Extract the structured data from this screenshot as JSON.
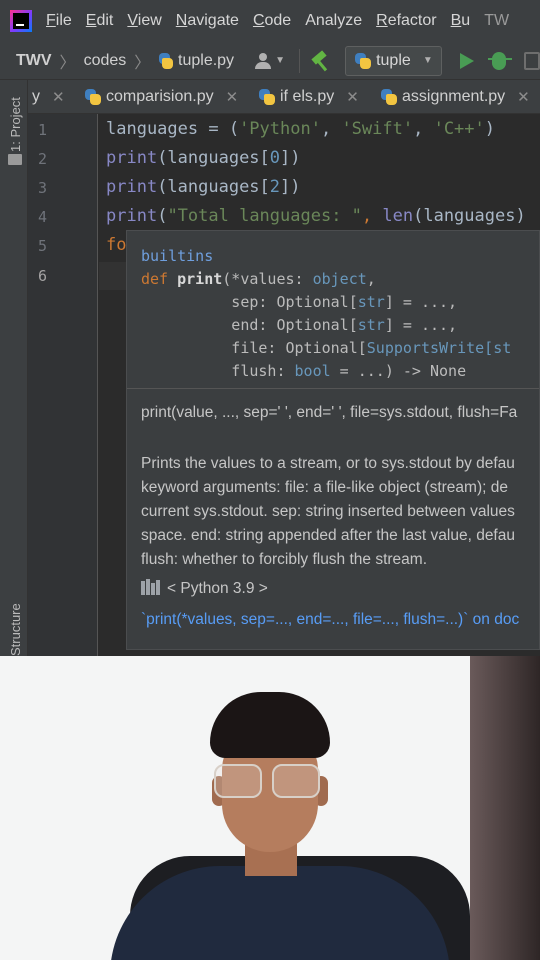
{
  "menubar": {
    "items": [
      {
        "label": "File",
        "mnemonic": "F",
        "rest": "ile"
      },
      {
        "label": "Edit",
        "mnemonic": "E",
        "rest": "dit"
      },
      {
        "label": "View",
        "mnemonic": "V",
        "rest": "iew"
      },
      {
        "label": "Navigate",
        "mnemonic": "N",
        "rest": "avigate"
      },
      {
        "label": "Code",
        "mnemonic": "C",
        "rest": "ode"
      },
      {
        "label": "Analyze",
        "mnemonic": "",
        "rest": "Analyze"
      },
      {
        "label": "Refactor",
        "mnemonic": "R",
        "rest": "efactor"
      },
      {
        "label": "Bu",
        "mnemonic": "B",
        "rest": "u"
      }
    ],
    "project_short": "TW"
  },
  "toolbar": {
    "breadcrumbs": [
      "TWV",
      "codes",
      "tuple.py"
    ],
    "run_config": "tuple"
  },
  "tool_windows": {
    "project": "1: Project",
    "structure": "Structure"
  },
  "tabs": [
    {
      "label": "y"
    },
    {
      "label": "comparision.py"
    },
    {
      "label": "if els.py"
    },
    {
      "label": "assignment.py"
    }
  ],
  "editor": {
    "line_numbers": [
      "1",
      "2",
      "3",
      "4",
      "5",
      "6"
    ],
    "current_line": "6",
    "lines": [
      {
        "parts": [
          {
            "t": "languages = (",
            "c": ""
          },
          {
            "t": "'Python'",
            "c": "str"
          },
          {
            "t": ", ",
            "c": ""
          },
          {
            "t": "'Swift'",
            "c": "str"
          },
          {
            "t": ", ",
            "c": ""
          },
          {
            "t": "'C++'",
            "c": "str"
          },
          {
            "t": ")",
            "c": ""
          }
        ]
      },
      {
        "parts": [
          {
            "t": "print",
            "c": "kw-fn"
          },
          {
            "t": "(languages[",
            "c": ""
          },
          {
            "t": "0",
            "c": "num"
          },
          {
            "t": "])",
            "c": ""
          }
        ]
      },
      {
        "parts": [
          {
            "t": "print",
            "c": "kw-fn"
          },
          {
            "t": "(languages[",
            "c": ""
          },
          {
            "t": "2",
            "c": "num"
          },
          {
            "t": "])",
            "c": ""
          }
        ]
      },
      {
        "parts": [
          {
            "t": "print",
            "c": "kw-fn"
          },
          {
            "t": "(",
            "c": ""
          },
          {
            "t": "\"Total languages: \"",
            "c": "str"
          },
          {
            "t": ", ",
            "c": "kw"
          },
          {
            "t": "len",
            "c": "kw-fn"
          },
          {
            "t": "(languages)",
            "c": ""
          }
        ]
      },
      {
        "parts": [
          {
            "t": "fo",
            "c": "kw"
          }
        ]
      },
      {
        "parts": []
      }
    ]
  },
  "quick_doc": {
    "module": "builtins",
    "signature_lines": [
      [
        {
          "t": "def ",
          "c": "m-kw"
        },
        {
          "t": "print",
          "c": "m-b"
        },
        {
          "t": "(*values: ",
          "c": ""
        },
        {
          "t": "object",
          "c": "m-type"
        },
        {
          "t": ",",
          "c": ""
        }
      ],
      [
        {
          "t": "          sep: Optional[",
          "c": ""
        },
        {
          "t": "str",
          "c": "m-type"
        },
        {
          "t": "] = ...,",
          "c": ""
        }
      ],
      [
        {
          "t": "          end: Optional[",
          "c": ""
        },
        {
          "t": "str",
          "c": "m-type"
        },
        {
          "t": "] = ...,",
          "c": ""
        }
      ],
      [
        {
          "t": "          file: Optional[",
          "c": ""
        },
        {
          "t": "SupportsWrite[st",
          "c": "m-type"
        }
      ],
      [
        {
          "t": "          flush: ",
          "c": ""
        },
        {
          "t": "bool",
          "c": "m-type"
        },
        {
          "t": " = ...) -> None",
          "c": ""
        }
      ]
    ],
    "short_signature": "print(value, ..., sep=' ', end=' ', file=sys.stdout, flush=Fa",
    "description_lines": [
      "Prints the values to a stream, or to sys.stdout by defau",
      "keyword arguments: file: a file-like object (stream); de",
      "current sys.stdout. sep: string inserted between values",
      "space. end: string appended after the last value, defau",
      "flush: whether to forcibly flush the stream."
    ],
    "library": "< Python 3.9 >",
    "external_link": "`print(*values, sep=..., end=..., file=..., flush=...)` on doc"
  },
  "colors": {
    "bg": "#2b2b2b",
    "chrome": "#3c3f41",
    "string": "#6a8759",
    "keyword": "#cc7832",
    "number": "#6897bb",
    "builtin": "#8888c6",
    "link": "#589df6",
    "run_green": "#499c54"
  }
}
